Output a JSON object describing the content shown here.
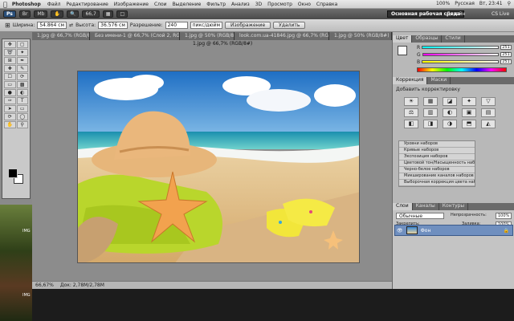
{
  "menubar": {
    "apple": "",
    "app": "Photoshop",
    "items": [
      "Файл",
      "Редактирование",
      "Изображение",
      "Слои",
      "Выделение",
      "Фильтр",
      "Анализ",
      "3D",
      "Просмотр",
      "Окно",
      "Справка"
    ],
    "status": [
      "100%",
      "Русская",
      "Вт, 23:41"
    ]
  },
  "appbar": {
    "mode": "Ps",
    "zoom": "66,7",
    "workspace": "Основная рабочая среда",
    "design": "Дизайн",
    "cslive": "CS Live"
  },
  "options": {
    "width_label": "Ширина:",
    "width_value": "54.864 см",
    "height_label": "Высота:",
    "height_value": "36.576 см",
    "resolution_label": "Разрешение:",
    "resolution_value": "240",
    "resolution_unit": "пикс/дюйм",
    "image_btn": "Изображение",
    "delete_btn": "Удалить"
  },
  "tabs": [
    "1.jpg @ 66,7% (RGB/8#)",
    "Без имени-1 @ 66,7% (Слой 2, RGB/8)",
    "1.jpg @ 50% (RGB/8#)",
    "look.com.ua-41846.jpg @ 66,7% (RGB/8#)",
    "1.jpg @ 50% (RGB/8#)"
  ],
  "canvas": {
    "title": "1.jpg @ 66,7% (RGB/8#)"
  },
  "status": {
    "zoom": "66,67%",
    "doc": "Док: 2,78M/2,78M"
  },
  "color_panel": {
    "tabs": [
      "Цвет",
      "Образцы",
      "Стили"
    ],
    "r_label": "R",
    "r_value": "251",
    "g_label": "G",
    "g_value": "251",
    "b_label": "B",
    "b_value": "251"
  },
  "adjust_panel": {
    "tabs": [
      "Коррекция",
      "Маски"
    ],
    "heading": "Добавить корректировку",
    "icons": [
      "☀",
      "▦",
      "◪",
      "✦",
      "▽",
      "⚖",
      "▥",
      "◐",
      "▣",
      "▤",
      "◧",
      "◨",
      "◑",
      "⬒",
      "◭"
    ],
    "presets": [
      "Уровни наборов",
      "Кривые наборов",
      "Экспозиция наборов",
      "Цветовой тон/Насыщенность наборов",
      "Черно-белое наборов",
      "Микширование каналов наборов",
      "Выборочная коррекция цвета наборов"
    ]
  },
  "layers_panel": {
    "tabs": [
      "Слои",
      "Каналы",
      "Контуры"
    ],
    "blend": "Обычные",
    "opacity_label": "Непрозрачность:",
    "opacity": "100%",
    "fill_label": "Заливка:",
    "fill": "100%",
    "lock_label": "Закрепить:",
    "layer_name": "Фон"
  },
  "desktop": {
    "label1": "IMG",
    "label2": "IMG"
  }
}
